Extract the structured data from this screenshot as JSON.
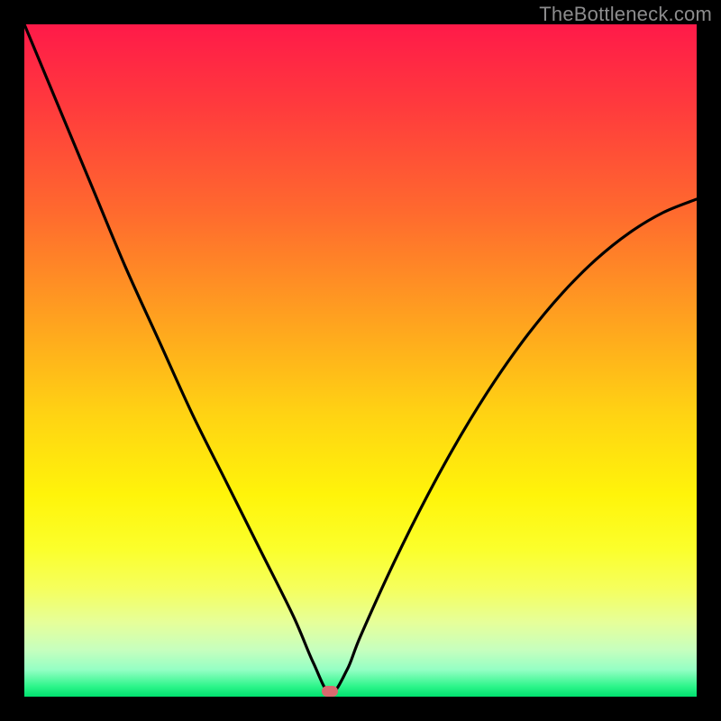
{
  "watermark": "TheBottleneck.com",
  "marker": {
    "color": "#d96a6f",
    "x_frac": 0.455,
    "y_frac": 0.992
  },
  "chart_data": {
    "type": "line",
    "title": "",
    "xlabel": "",
    "ylabel": "",
    "xlim": [
      0,
      100
    ],
    "ylim": [
      0,
      100
    ],
    "grid": false,
    "legend": false,
    "background": "rainbow-gradient (red top → green bottom)",
    "annotations": [
      {
        "type": "marker",
        "shape": "rounded-rect",
        "x": 45.5,
        "y": 0.8,
        "color": "#d96a6f"
      }
    ],
    "series": [
      {
        "name": "bottleneck-curve",
        "x": [
          0,
          5,
          10,
          15,
          20,
          25,
          30,
          35,
          40,
          43,
          45.5,
          48,
          50,
          55,
          60,
          65,
          70,
          75,
          80,
          85,
          90,
          95,
          100
        ],
        "y": [
          100,
          88,
          76,
          64,
          53,
          42,
          32,
          22,
          12,
          5,
          0.5,
          4,
          9,
          20,
          30,
          39,
          47,
          54,
          60,
          65,
          69,
          72,
          74
        ]
      }
    ]
  }
}
